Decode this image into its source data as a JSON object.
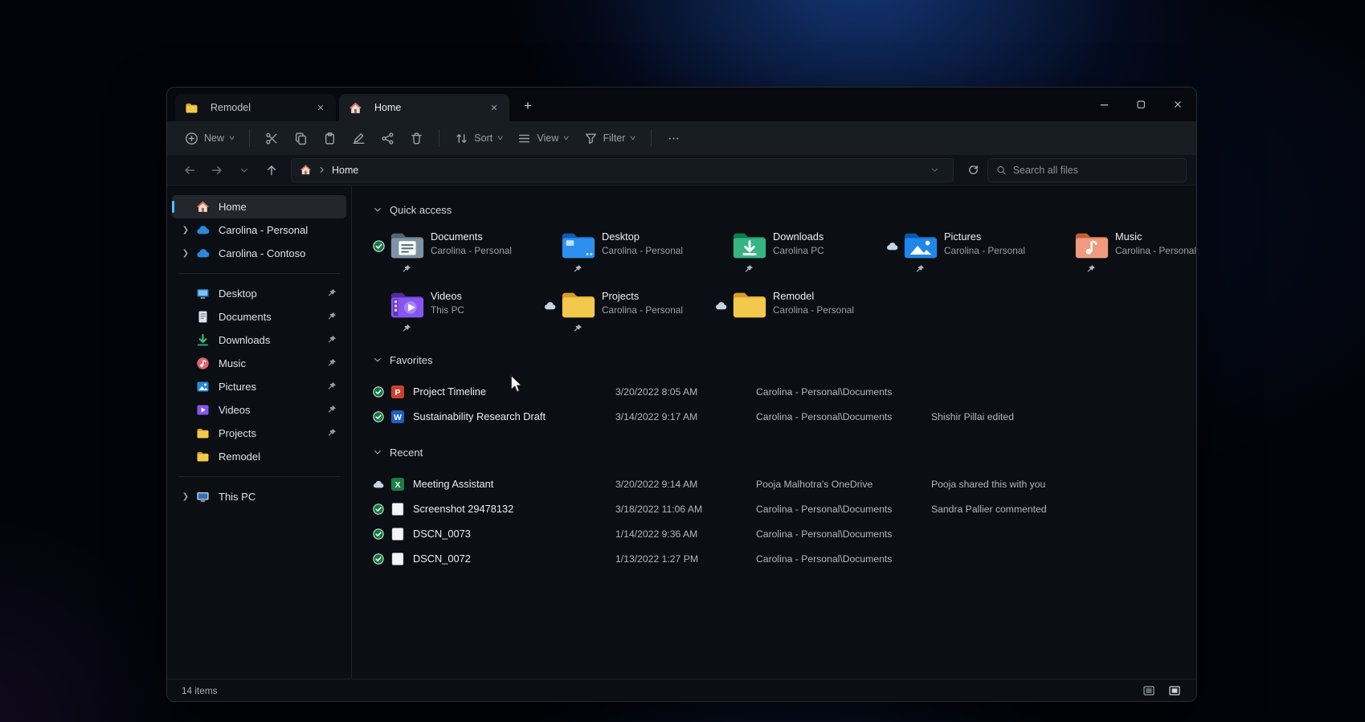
{
  "colors": {
    "accent": "#4cc2ff",
    "window_bg": "#0c0f14",
    "toolbar_bg": "#181c23",
    "folder_yellow": "#f2c94c",
    "synced_green": "#0e7a3d",
    "onedrive_blue": "#2b88d8"
  },
  "tabs": [
    {
      "label": "Remodel",
      "icon": "folder-mini",
      "active": false
    },
    {
      "label": "Home",
      "icon": "home",
      "active": true
    }
  ],
  "window_controls": {
    "minimize": "minimize",
    "maximize": "maximize",
    "close": "close"
  },
  "toolbar": {
    "new_label": "New",
    "sort_label": "Sort",
    "view_label": "View",
    "filter_label": "Filter"
  },
  "address": {
    "breadcrumb": "Home",
    "search_placeholder": "Search all files"
  },
  "sidebar": {
    "items": [
      {
        "label": "Home",
        "icon": "home",
        "selected": true
      },
      {
        "label": "Carolina - Personal",
        "icon": "cloud",
        "chevron": true
      },
      {
        "label": "Carolina - Contoso",
        "icon": "cloud",
        "chevron": true
      },
      {
        "divider": true
      },
      {
        "label": "Desktop",
        "icon": "desktop-mini",
        "pinned": true
      },
      {
        "label": "Documents",
        "icon": "documents-mini",
        "pinned": true
      },
      {
        "label": "Downloads",
        "icon": "downloads-mini",
        "pinned": true
      },
      {
        "label": "Music",
        "icon": "music-mini",
        "pinned": true
      },
      {
        "label": "Pictures",
        "icon": "pictures-mini",
        "pinned": true
      },
      {
        "label": "Videos",
        "icon": "videos-mini",
        "pinned": true
      },
      {
        "label": "Projects",
        "icon": "folder-mini",
        "pinned": true
      },
      {
        "label": "Remodel",
        "icon": "folder-mini"
      },
      {
        "divider": true
      },
      {
        "label": "This PC",
        "icon": "thispc",
        "chevron": true
      }
    ]
  },
  "quick_access": {
    "title": "Quick access",
    "tiles": [
      {
        "name": "Documents",
        "sub": "Carolina - Personal",
        "icon": "folder-documents",
        "badge": "synced",
        "pinned": true
      },
      {
        "name": "Desktop",
        "sub": "Carolina - Personal",
        "icon": "folder-desktop",
        "pinned": true
      },
      {
        "name": "Downloads",
        "sub": "Carolina PC",
        "icon": "folder-downloads",
        "pinned": true
      },
      {
        "name": "Pictures",
        "sub": "Carolina - Personal",
        "icon": "folder-pictures",
        "badge": "cloud-status",
        "pinned": true
      },
      {
        "name": "Music",
        "sub": "Carolina - Personal",
        "icon": "folder-music",
        "pinned": true
      },
      {
        "name": "Videos",
        "sub": "This PC",
        "icon": "folder-videos",
        "pinned": true
      },
      {
        "name": "Projects",
        "sub": "Carolina - Personal",
        "icon": "folder-yellow",
        "badge": "cloud-status",
        "pinned": true
      },
      {
        "name": "Remodel",
        "sub": "Carolina - Personal",
        "icon": "folder-yellow",
        "badge": "cloud-status"
      }
    ]
  },
  "favorites": {
    "title": "Favorites",
    "rows": [
      {
        "name": "Project Timeline",
        "icon": "powerpoint",
        "badge": "synced",
        "date": "3/20/2022 8:05 AM",
        "path": "Carolina - Personal\\Documents",
        "note": ""
      },
      {
        "name": "Sustainability Research Draft",
        "icon": "word",
        "badge": "synced",
        "date": "3/14/2022 9:17 AM",
        "path": "Carolina - Personal\\Documents",
        "note": "Shishir Pillai edited"
      }
    ]
  },
  "recent": {
    "title": "Recent",
    "rows": [
      {
        "name": "Meeting Assistant",
        "icon": "excel",
        "badge": "cloud-status",
        "date": "3/20/2022 9:14 AM",
        "path": "Pooja Malhotra's OneDrive",
        "note": "Pooja shared this with you"
      },
      {
        "name": "Screenshot 29478132",
        "icon": "image",
        "badge": "synced",
        "date": "3/18/2022 11:06 AM",
        "path": "Carolina - Personal\\Documents",
        "note": "Sandra Pallier commented"
      },
      {
        "name": "DSCN_0073",
        "icon": "image",
        "badge": "synced",
        "date": "1/14/2022 9:36 AM",
        "path": "Carolina - Personal\\Documents",
        "note": ""
      },
      {
        "name": "DSCN_0072",
        "icon": "image",
        "badge": "synced",
        "date": "1/13/2022 1:27 PM",
        "path": "Carolina - Personal\\Documents",
        "note": ""
      }
    ]
  },
  "status_bar": {
    "count": "14 items"
  }
}
